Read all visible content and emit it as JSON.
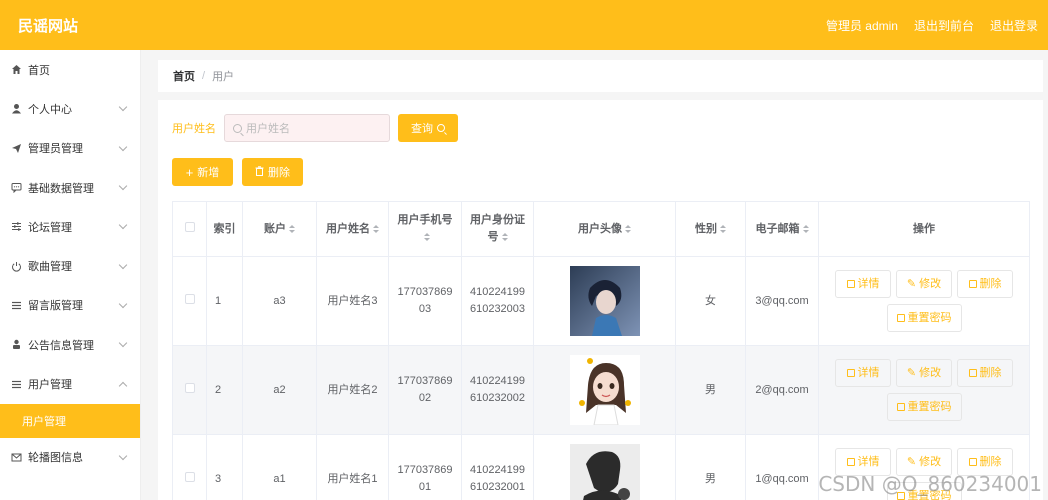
{
  "header": {
    "brand": "民谣网站",
    "admin_label": "管理员 admin",
    "front_link": "退出到前台",
    "logout_link": "退出登录"
  },
  "sidebar": {
    "items": [
      {
        "label": "首页",
        "icon": "home-icon"
      },
      {
        "label": "个人中心",
        "icon": "user-icon"
      },
      {
        "label": "管理员管理",
        "icon": "send-icon"
      },
      {
        "label": "基础数据管理",
        "icon": "chat-icon"
      },
      {
        "label": "论坛管理",
        "icon": "sliders-icon"
      },
      {
        "label": "歌曲管理",
        "icon": "power-icon"
      },
      {
        "label": "留言版管理",
        "icon": "list-icon"
      },
      {
        "label": "公告信息管理",
        "icon": "person-icon"
      },
      {
        "label": "用户管理",
        "icon": "list-icon"
      },
      {
        "label": "轮播图信息",
        "icon": "mail-icon"
      }
    ],
    "active_sub": "用户管理"
  },
  "breadcrumb": {
    "home": "首页",
    "sep": "/",
    "current": "用户"
  },
  "search": {
    "label": "用户姓名",
    "placeholder": "用户姓名",
    "query_button": "查询"
  },
  "actions": {
    "add": "新增",
    "delete": "删除"
  },
  "table": {
    "headers": {
      "index": "索引",
      "account": "账户",
      "name": "用户姓名",
      "phone": "用户手机号",
      "idcard": "用户身份证号",
      "avatar": "用户头像",
      "gender": "性别",
      "email": "电子邮箱",
      "ops": "操作"
    },
    "rows": [
      {
        "index": "1",
        "account": "a3",
        "name": "用户姓名3",
        "phone": "17703786903",
        "idcard": "410224199610232003",
        "gender": "女",
        "email": "3@qq.com"
      },
      {
        "index": "2",
        "account": "a2",
        "name": "用户姓名2",
        "phone": "17703786902",
        "idcard": "410224199610232002",
        "gender": "男",
        "email": "2@qq.com"
      },
      {
        "index": "3",
        "account": "a1",
        "name": "用户姓名1",
        "phone": "17703786901",
        "idcard": "410224199610232001",
        "gender": "男",
        "email": "1@qq.com"
      }
    ],
    "row_ops": {
      "detail": "详情",
      "edit": "修改",
      "delete": "删除",
      "reset": "重置密码"
    }
  },
  "watermark": "CSDN @O_860234001",
  "colors": {
    "accent": "#ffbe1a"
  }
}
